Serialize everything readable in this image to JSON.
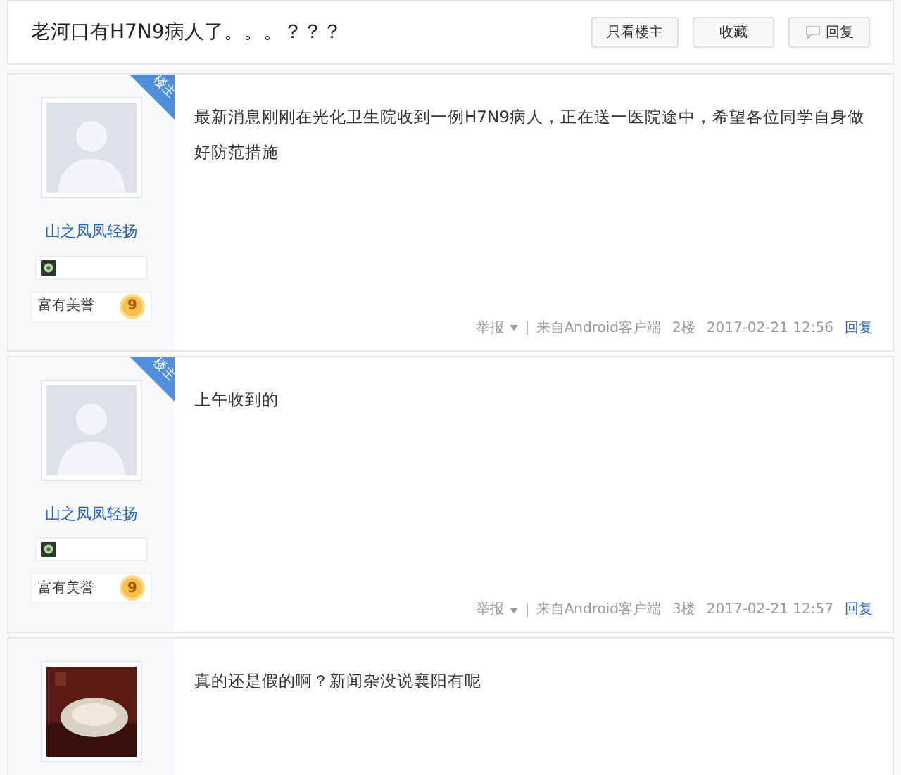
{
  "thread": {
    "title": "老河口有H7N9病人了。。。？？？",
    "buttons": [
      {
        "label": "只看楼主",
        "kind": "plain"
      },
      {
        "label": "收藏",
        "kind": "plain"
      },
      {
        "label": "回复",
        "kind": "reply"
      }
    ]
  },
  "posts": [
    {
      "avatar": {
        "kind": "default"
      },
      "owner_badge": "楼主",
      "username": "山之凤凤轻扬",
      "honor": "富有美誉",
      "honor_level": "9",
      "content": "最新消息刚刚在光化卫生院收到一例H7N9病人，正在送一医院途中，希望各位同学自身做好防范措施",
      "report": "举报",
      "source": "来自Android客户端",
      "floor": "2楼",
      "time": "2017-02-21 12:56",
      "reply": "回复"
    },
    {
      "avatar": {
        "kind": "default"
      },
      "owner_badge": "楼主",
      "username": "山之凤凤轻扬",
      "honor": "富有美誉",
      "honor_level": "9",
      "content": "上午收到的",
      "report": "举报",
      "source": "来自Android客户端",
      "floor": "3楼",
      "time": "2017-02-21 12:57",
      "reply": "回复"
    },
    {
      "content": "真的还是假的啊？新闻杂没说襄阳有呢"
    }
  ]
}
